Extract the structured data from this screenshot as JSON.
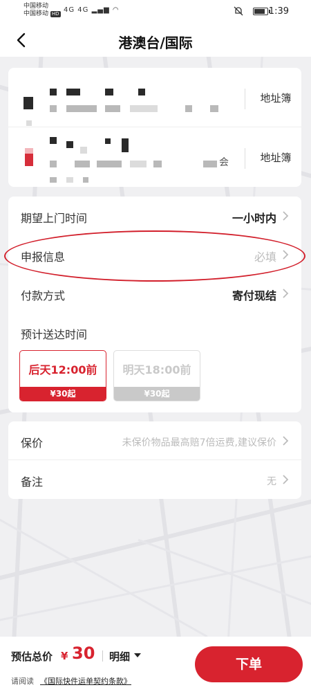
{
  "status_bar": {
    "carrier_1": "中国移动",
    "carrier_2": "中国移动",
    "hd": "HD",
    "network": "4G 4G",
    "time": "1:39",
    "icons": [
      "signal-icon",
      "wifi-icon",
      "mute-icon",
      "battery-icon"
    ]
  },
  "header": {
    "title": "港澳台/国际",
    "back_icon": "back-arrow-icon"
  },
  "address": {
    "sender": {
      "book_label": "地址簿"
    },
    "receiver": {
      "hint_suffix": "会",
      "book_label": "地址簿"
    }
  },
  "options": {
    "pickup_time": {
      "label": "期望上门时间",
      "value": "一小时内"
    },
    "declaration": {
      "label": "申报信息",
      "value": "必填"
    },
    "payment": {
      "label": "付款方式",
      "value": "寄付现结"
    },
    "eta": {
      "label": "预计送达时间",
      "choices": [
        {
          "time": "后天12:00前",
          "price": "¥30起",
          "selected": true
        },
        {
          "time": "明天18:00前",
          "price": "¥30起",
          "selected": false
        }
      ]
    }
  },
  "extras": {
    "insurance": {
      "label": "保价",
      "value": "未保价物品最高赔7倍运费,建议保价"
    },
    "remark": {
      "label": "备注",
      "value": "无"
    }
  },
  "bottom": {
    "est_label": "预估总价",
    "currency": "¥",
    "price": "30",
    "detail_label": "明细",
    "terms_prefix": "请阅读",
    "terms_link": "《国际快件运单契约条款》",
    "order_label": "下单"
  },
  "colors": {
    "accent": "#d8232f",
    "annotation": "#d21f2b",
    "placeholder": "#bbbbbb",
    "disabled": "#c9c9c9"
  }
}
